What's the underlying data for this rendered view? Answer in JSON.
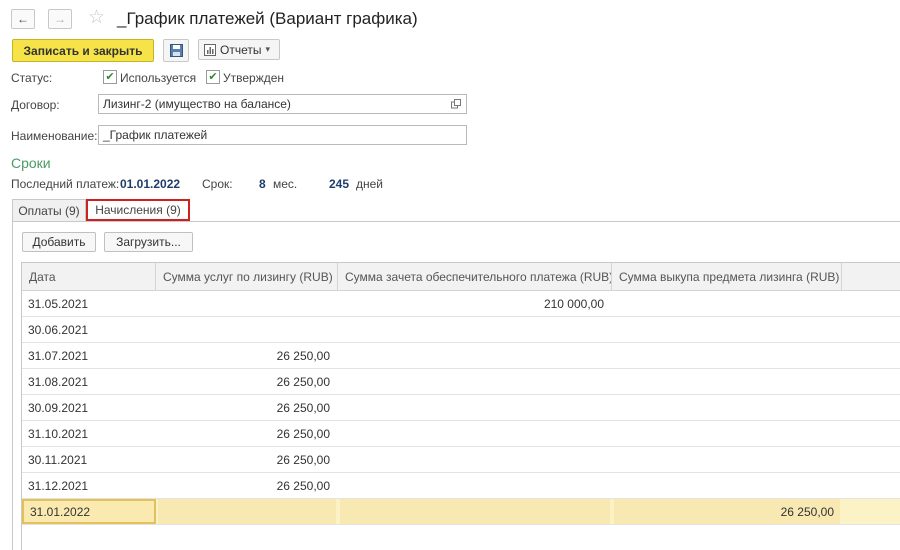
{
  "window": {
    "title": "_График платежей (Вариант графика)",
    "back_icon": "arrow-left-icon",
    "forward_icon": "arrow-right-icon",
    "favorite_icon": "star-icon",
    "back_glyph": "←",
    "forward_glyph": "→",
    "star_glyph": "☆"
  },
  "toolbar": {
    "save_close_label": "Записать и закрыть",
    "save_icon": "floppy-disk-icon",
    "reports_label": "Отчеты",
    "reports_caret": "▾",
    "accent_color": "#f5e348"
  },
  "form": {
    "status_label": "Статус:",
    "used_label": "Используется",
    "used_checked": true,
    "approved_label": "Утвержден",
    "approved_checked": true,
    "check_glyph": "✔",
    "contract_label": "Договор:",
    "contract_value": "Лизинг-2 (имущество на балансе)",
    "name_label": "Наименование:",
    "name_value": "_График платежей"
  },
  "terms": {
    "section_title": "Сроки",
    "last_payment_label": "Последний платеж:",
    "last_payment_value": "01.01.2022",
    "term_label": "Срок:",
    "months_value": "8",
    "months_unit": "мес.",
    "days_value": "245",
    "days_unit": "дней"
  },
  "tabs": [
    {
      "label": "Оплаты (9)",
      "active": false
    },
    {
      "label": "Начисления (9)",
      "active": true
    }
  ],
  "table_toolbar": {
    "add_label": "Добавить",
    "load_label": "Загрузить..."
  },
  "table": {
    "columns": [
      "Дата",
      "Сумма услуг по лизингу (RUB)",
      "Сумма зачета обеспечительного платежа (RUB)",
      "Сумма выкупа предмета лизинга (RUB)"
    ],
    "rows": [
      {
        "date": "31.05.2021",
        "service": "",
        "offset": "210 000,00",
        "buyout": ""
      },
      {
        "date": "30.06.2021",
        "service": "",
        "offset": "",
        "buyout": ""
      },
      {
        "date": "31.07.2021",
        "service": "26 250,00",
        "offset": "",
        "buyout": ""
      },
      {
        "date": "31.08.2021",
        "service": "26 250,00",
        "offset": "",
        "buyout": ""
      },
      {
        "date": "30.09.2021",
        "service": "26 250,00",
        "offset": "",
        "buyout": ""
      },
      {
        "date": "31.10.2021",
        "service": "26 250,00",
        "offset": "",
        "buyout": ""
      },
      {
        "date": "30.11.2021",
        "service": "26 250,00",
        "offset": "",
        "buyout": ""
      },
      {
        "date": "31.12.2021",
        "service": "26 250,00",
        "offset": "",
        "buyout": ""
      },
      {
        "date": "31.01.2022",
        "service": "",
        "offset": "",
        "buyout": "26 250,00",
        "selected": true
      }
    ]
  }
}
